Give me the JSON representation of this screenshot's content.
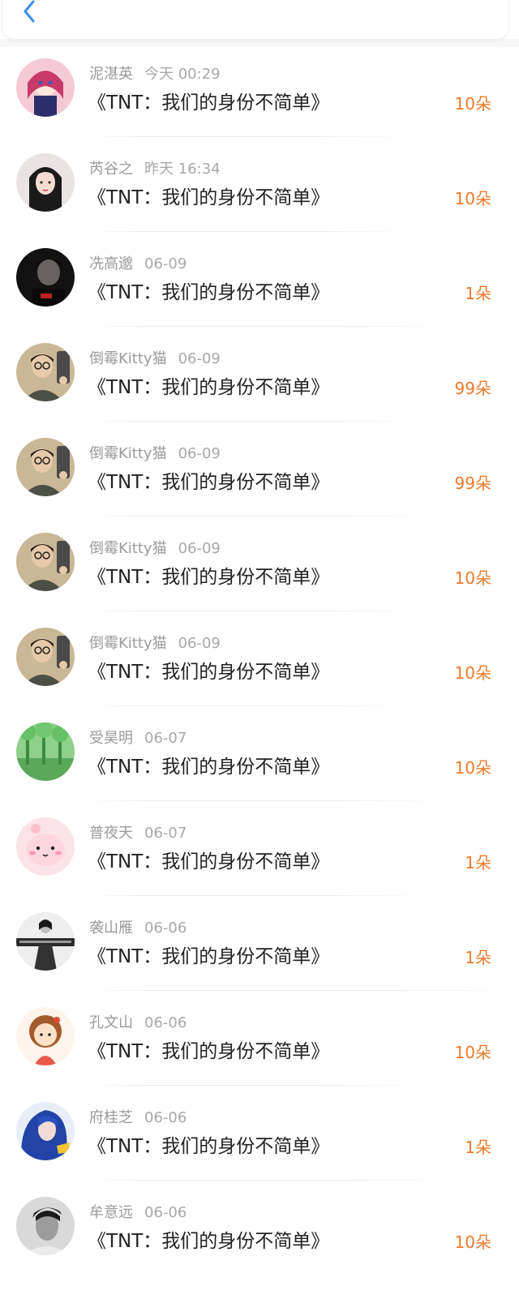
{
  "header": {
    "back_icon": "chevron-left-icon",
    "accent": "#3b8ef0"
  },
  "colors": {
    "count": "#f07a2a",
    "name": "#9a9a9a",
    "title": "#222222"
  },
  "gifts": [
    {
      "name": "泥湛英",
      "time": "今天 00:29",
      "title": "《TNT：我们的身份不简单》",
      "count": "10朵",
      "avatar": "anime-girl-avatar"
    },
    {
      "name": "芮谷之",
      "time": "昨天 16:34",
      "title": "《TNT：我们的身份不简单》",
      "count": "10朵",
      "avatar": "girl-portrait-avatar"
    },
    {
      "name": "冼高邈",
      "time": "06-09",
      "title": "《TNT：我们的身份不简单》",
      "count": "1朵",
      "avatar": "boy-dark-avatar"
    },
    {
      "name": "倒霉Kitty猫",
      "time": "06-09",
      "title": "《TNT：我们的身份不简单》",
      "count": "99朵",
      "avatar": "mirror-selfie-avatar"
    },
    {
      "name": "倒霉Kitty猫",
      "time": "06-09",
      "title": "《TNT：我们的身份不简单》",
      "count": "99朵",
      "avatar": "mirror-selfie-avatar"
    },
    {
      "name": "倒霉Kitty猫",
      "time": "06-09",
      "title": "《TNT：我们的身份不简单》",
      "count": "10朵",
      "avatar": "mirror-selfie-avatar"
    },
    {
      "name": "倒霉Kitty猫",
      "time": "06-09",
      "title": "《TNT：我们的身份不简单》",
      "count": "10朵",
      "avatar": "mirror-selfie-avatar"
    },
    {
      "name": "受昊明",
      "time": "06-07",
      "title": "《TNT：我们的身份不简单》",
      "count": "10朵",
      "avatar": "green-forest-avatar"
    },
    {
      "name": "普夜天",
      "time": "06-07",
      "title": "《TNT：我们的身份不简单》",
      "count": "1朵",
      "avatar": "pink-cartoon-avatar"
    },
    {
      "name": "袭山雁",
      "time": "06-06",
      "title": "《TNT：我们的身份不简单》",
      "count": "1朵",
      "avatar": "girl-bw-caption-avatar"
    },
    {
      "name": "孔文山",
      "time": "06-06",
      "title": "《TNT：我们的身份不简单》",
      "count": "10朵",
      "avatar": "cartoon-girl-avatar"
    },
    {
      "name": "府桂芝",
      "time": "06-06",
      "title": "《TNT：我们的身份不简单》",
      "count": "1朵",
      "avatar": "blue-hair-avatar"
    },
    {
      "name": "牟意远",
      "time": "06-06",
      "title": "《TNT：我们的身份不简单》",
      "count": "10朵",
      "avatar": "man-bw-avatar"
    }
  ]
}
